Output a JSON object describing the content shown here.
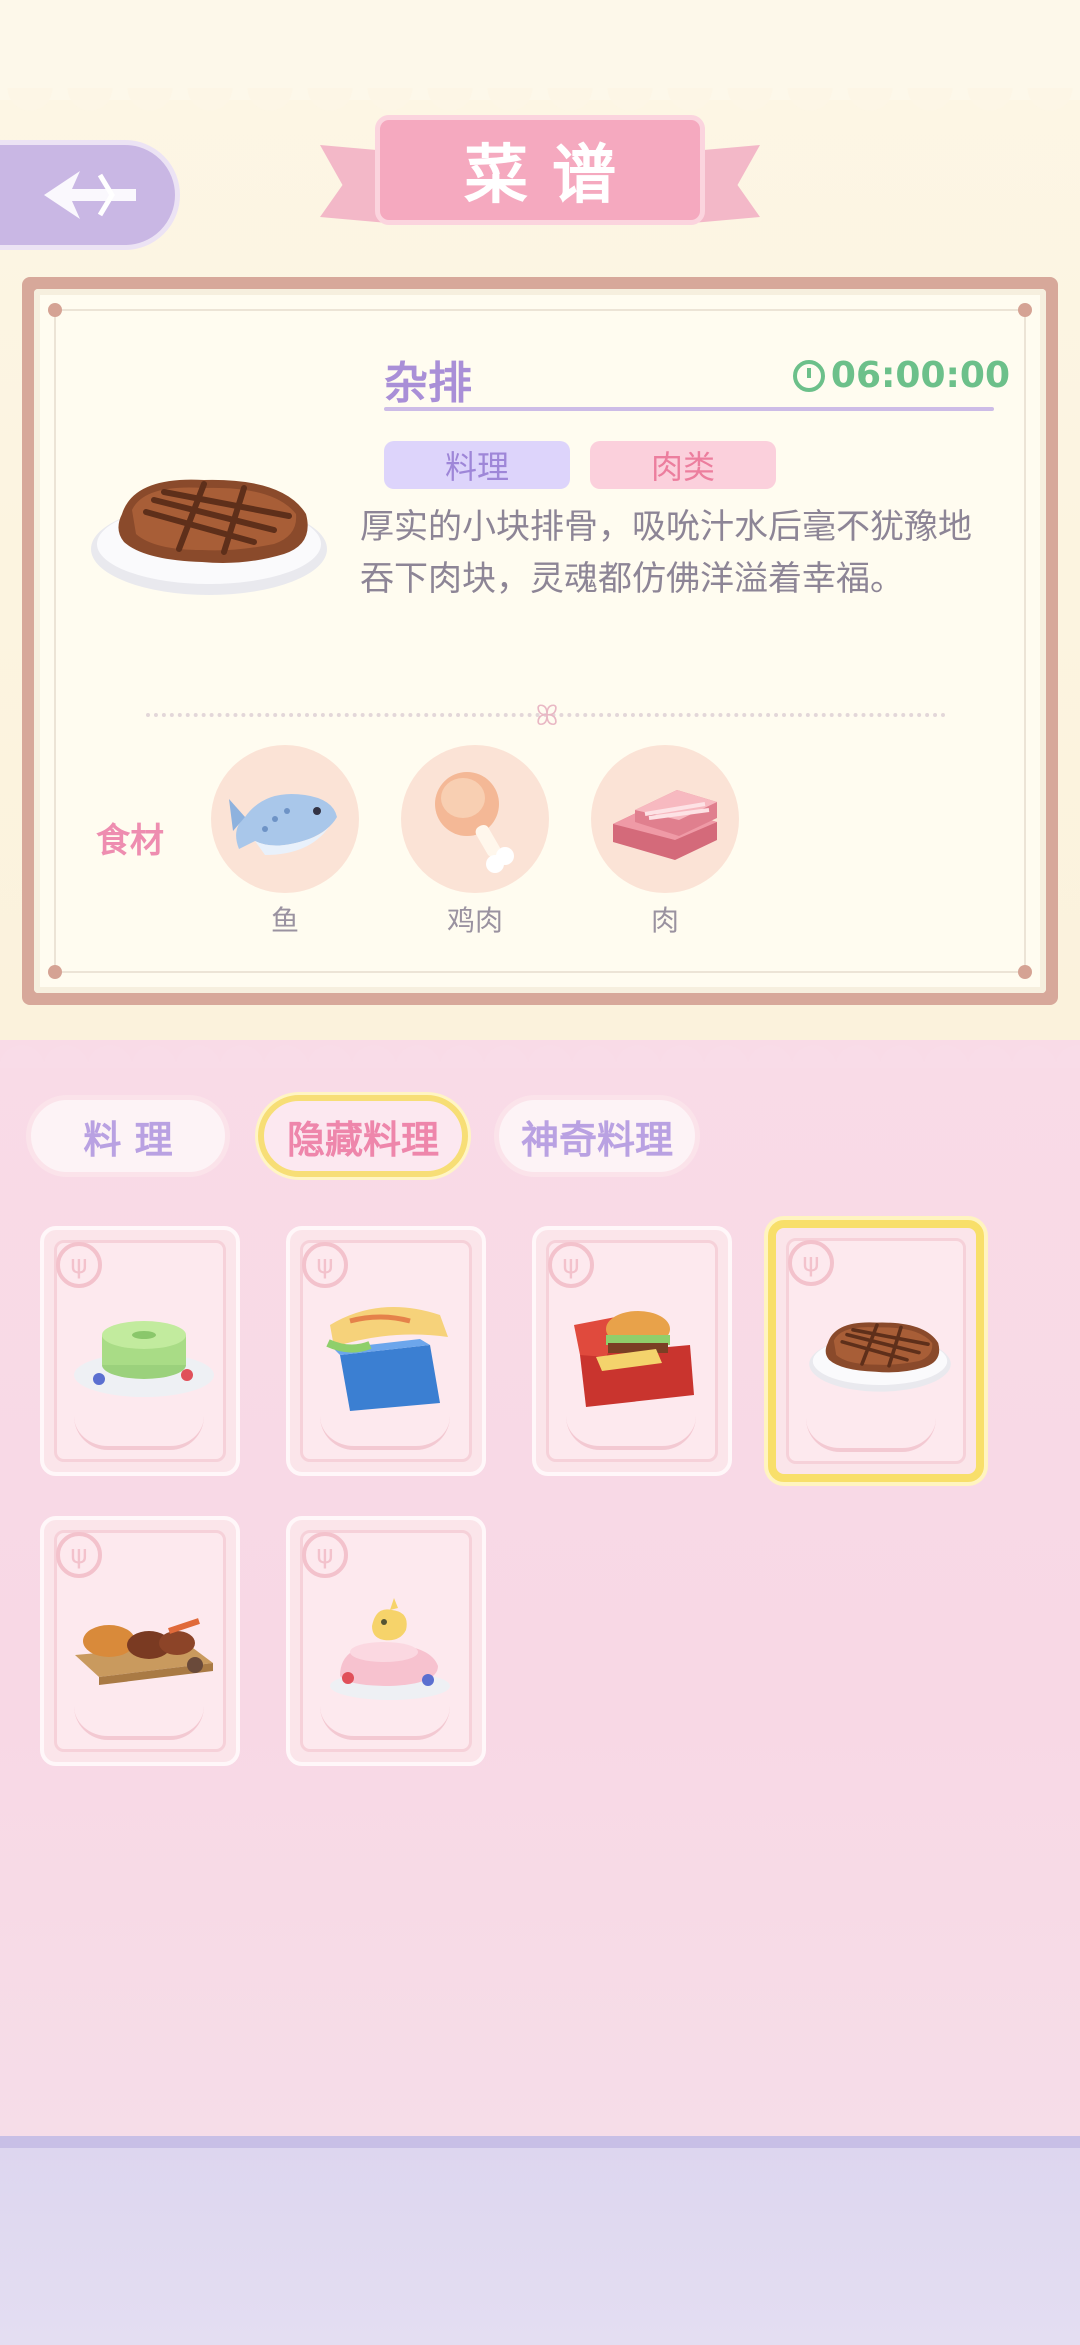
{
  "header": {
    "title": "菜谱",
    "back_icon": "back-arrow-icon"
  },
  "detail": {
    "name": "杂排",
    "timer": "06:00:00",
    "tags": [
      "料理",
      "肉类"
    ],
    "description": "厚实的小块排骨，吸吮汁水后毫不犹豫地吞下肉块，灵魂都仿佛洋溢着幸福。",
    "ingredients_label": "食材",
    "ingredients": [
      {
        "name": "鱼",
        "icon": "fish-icon"
      },
      {
        "name": "鸡肉",
        "icon": "chicken-leg-icon"
      },
      {
        "name": "肉",
        "icon": "meat-slab-icon"
      }
    ]
  },
  "tabs": [
    {
      "label": "料 理",
      "active": false
    },
    {
      "label": "隐藏料理",
      "active": true
    },
    {
      "label": "神奇料理",
      "active": false
    }
  ],
  "recipes": [
    {
      "icon": "green-pancake-icon",
      "selected": false
    },
    {
      "icon": "sandwich-box-icon",
      "selected": false
    },
    {
      "icon": "burger-box-icon",
      "selected": false
    },
    {
      "icon": "steak-plate-icon",
      "selected": true
    },
    {
      "icon": "grilled-platter-icon",
      "selected": false
    },
    {
      "icon": "chick-cake-icon",
      "selected": false
    }
  ],
  "colors": {
    "accent_purple": "#a98fd7",
    "accent_pink": "#ee86ab",
    "timer_green": "#6cc08a",
    "selected_gold": "#f8df6a"
  }
}
